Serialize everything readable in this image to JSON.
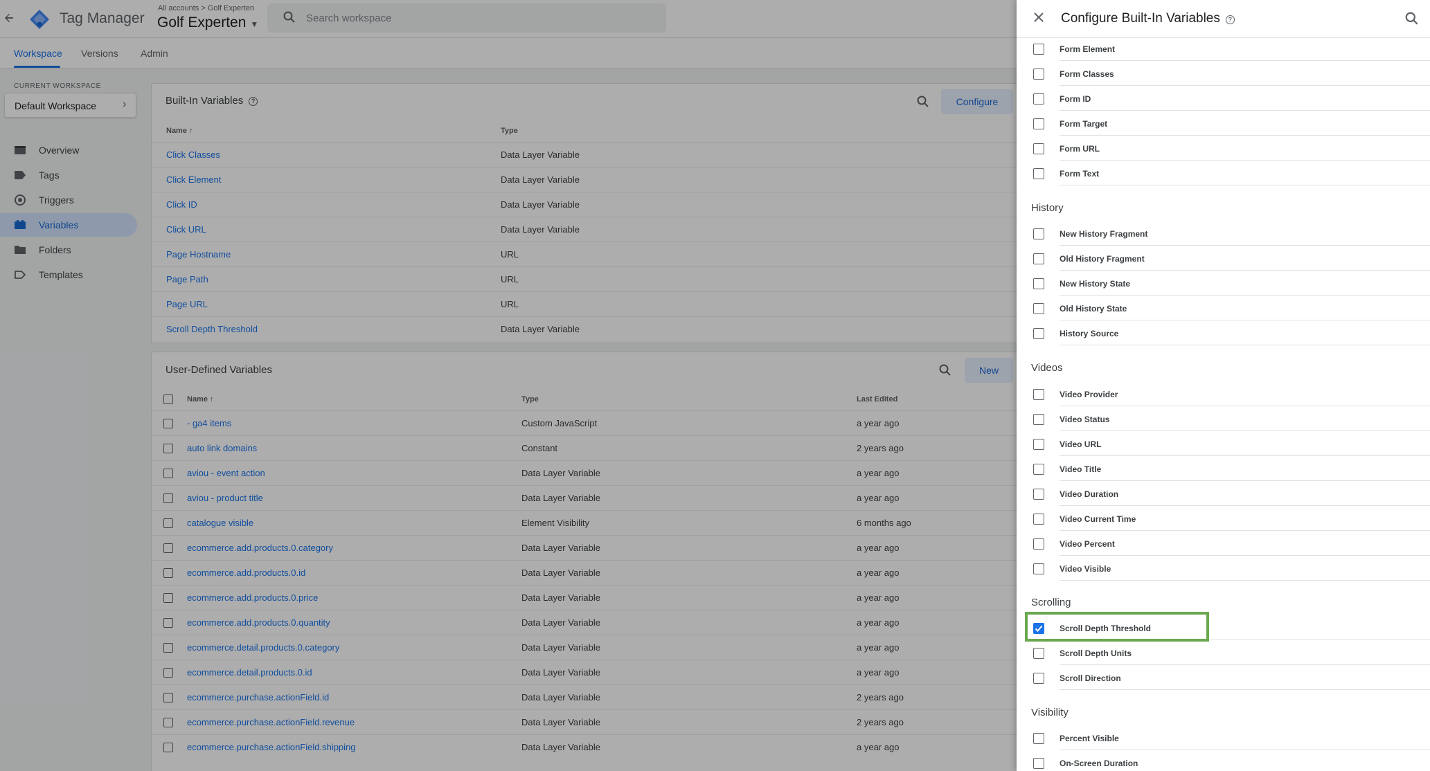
{
  "header": {
    "app_title": "Tag Manager",
    "breadcrumb_all": "All accounts",
    "breadcrumb_sep": ">",
    "breadcrumb_account": "Golf Experten",
    "container_name": "Golf Experten",
    "search_placeholder": "Search workspace"
  },
  "tabs": [
    "Workspace",
    "Versions",
    "Admin"
  ],
  "sidebar": {
    "current_workspace_label": "CURRENT WORKSPACE",
    "workspace_name": "Default Workspace",
    "items": [
      {
        "label": "Overview",
        "icon": "overview-icon"
      },
      {
        "label": "Tags",
        "icon": "tag-icon"
      },
      {
        "label": "Triggers",
        "icon": "trigger-icon"
      },
      {
        "label": "Variables",
        "icon": "variables-icon",
        "active": true
      },
      {
        "label": "Folders",
        "icon": "folder-icon"
      },
      {
        "label": "Templates",
        "icon": "template-icon"
      }
    ]
  },
  "builtin": {
    "title": "Built-In Variables",
    "configure_label": "Configure",
    "col_name": "Name",
    "col_type": "Type",
    "rows": [
      {
        "name": "Click Classes",
        "type": "Data Layer Variable"
      },
      {
        "name": "Click Element",
        "type": "Data Layer Variable"
      },
      {
        "name": "Click ID",
        "type": "Data Layer Variable"
      },
      {
        "name": "Click URL",
        "type": "Data Layer Variable"
      },
      {
        "name": "Page Hostname",
        "type": "URL"
      },
      {
        "name": "Page Path",
        "type": "URL"
      },
      {
        "name": "Page URL",
        "type": "URL"
      },
      {
        "name": "Scroll Depth Threshold",
        "type": "Data Layer Variable"
      }
    ]
  },
  "userdefined": {
    "title": "User-Defined Variables",
    "new_label": "New",
    "col_name": "Name",
    "col_type": "Type",
    "col_edited": "Last Edited",
    "rows": [
      {
        "name": "- ga4 items",
        "type": "Custom JavaScript",
        "edited": "a year ago"
      },
      {
        "name": "auto link domains",
        "type": "Constant",
        "edited": "2 years ago"
      },
      {
        "name": "aviou - event action",
        "type": "Data Layer Variable",
        "edited": "a year ago"
      },
      {
        "name": "aviou - product title",
        "type": "Data Layer Variable",
        "edited": "a year ago"
      },
      {
        "name": "catalogue visible",
        "type": "Element Visibility",
        "edited": "6 months ago"
      },
      {
        "name": "ecommerce.add.products.0.category",
        "type": "Data Layer Variable",
        "edited": "a year ago"
      },
      {
        "name": "ecommerce.add.products.0.id",
        "type": "Data Layer Variable",
        "edited": "a year ago"
      },
      {
        "name": "ecommerce.add.products.0.price",
        "type": "Data Layer Variable",
        "edited": "a year ago"
      },
      {
        "name": "ecommerce.add.products.0.quantity",
        "type": "Data Layer Variable",
        "edited": "a year ago"
      },
      {
        "name": "ecommerce.detail.products.0.category",
        "type": "Data Layer Variable",
        "edited": "a year ago"
      },
      {
        "name": "ecommerce.detail.products.0.id",
        "type": "Data Layer Variable",
        "edited": "a year ago"
      },
      {
        "name": "ecommerce.purchase.actionField.id",
        "type": "Data Layer Variable",
        "edited": "2 years ago"
      },
      {
        "name": "ecommerce.purchase.actionField.revenue",
        "type": "Data Layer Variable",
        "edited": "2 years ago"
      },
      {
        "name": "ecommerce.purchase.actionField.shipping",
        "type": "Data Layer Variable",
        "edited": "a year ago"
      }
    ]
  },
  "panel": {
    "title": "Configure Built-In Variables",
    "form_items": [
      "Form Element",
      "Form Classes",
      "Form ID",
      "Form Target",
      "Form URL",
      "Form Text"
    ],
    "history_title": "History",
    "history_items": [
      "New History Fragment",
      "Old History Fragment",
      "New History State",
      "Old History State",
      "History Source"
    ],
    "videos_title": "Videos",
    "video_items": [
      "Video Provider",
      "Video Status",
      "Video URL",
      "Video Title",
      "Video Duration",
      "Video Current Time",
      "Video Percent",
      "Video Visible"
    ],
    "scrolling_title": "Scrolling",
    "scrolling_items": [
      {
        "label": "Scroll Depth Threshold",
        "checked": true
      },
      {
        "label": "Scroll Depth Units",
        "checked": false
      },
      {
        "label": "Scroll Direction",
        "checked": false
      }
    ],
    "visibility_title": "Visibility",
    "visibility_items": [
      "Percent Visible",
      "On-Screen Duration"
    ]
  },
  "colors": {
    "accent": "#1a73e8",
    "highlight": "#6aa84f"
  }
}
